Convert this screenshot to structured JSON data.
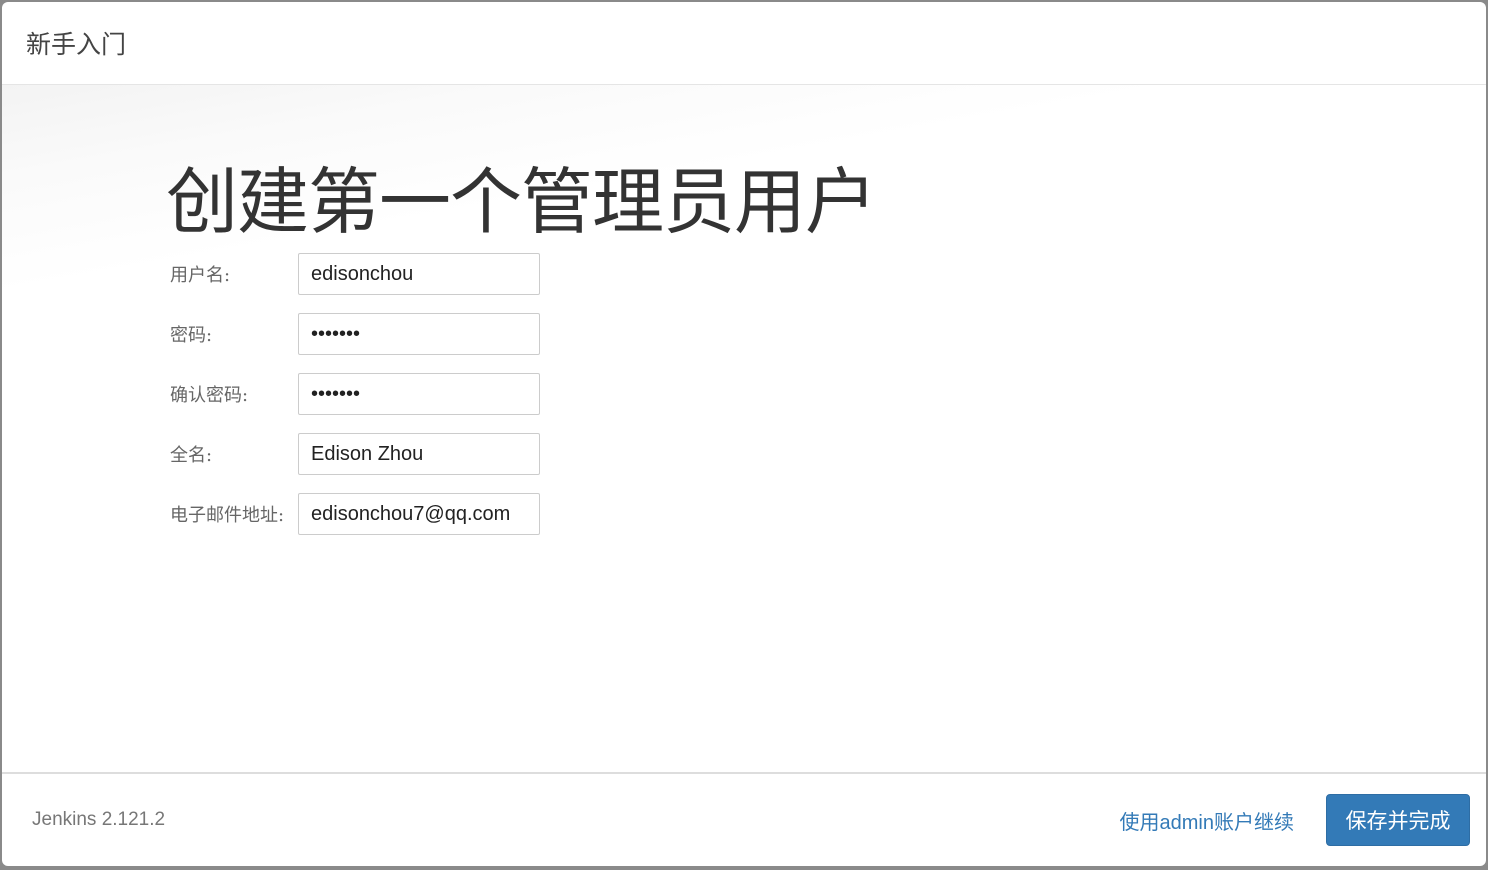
{
  "header": {
    "title": "新手入门"
  },
  "main": {
    "title": "创建第一个管理员用户",
    "fields": [
      {
        "label": "用户名:",
        "value": "edisonchou",
        "type": "text"
      },
      {
        "label": "密码:",
        "value": "1234567",
        "type": "password"
      },
      {
        "label": "确认密码:",
        "value": "1234567",
        "type": "password"
      },
      {
        "label": "全名:",
        "value": "Edison Zhou",
        "type": "text"
      },
      {
        "label": "电子邮件地址:",
        "value": "edisonchou7@qq.com",
        "type": "text"
      }
    ]
  },
  "footer": {
    "version": "Jenkins 2.121.2",
    "admin_link": "使用admin账户继续",
    "save_button": "保存并完成"
  },
  "colors": {
    "accent": "#337ab7"
  }
}
